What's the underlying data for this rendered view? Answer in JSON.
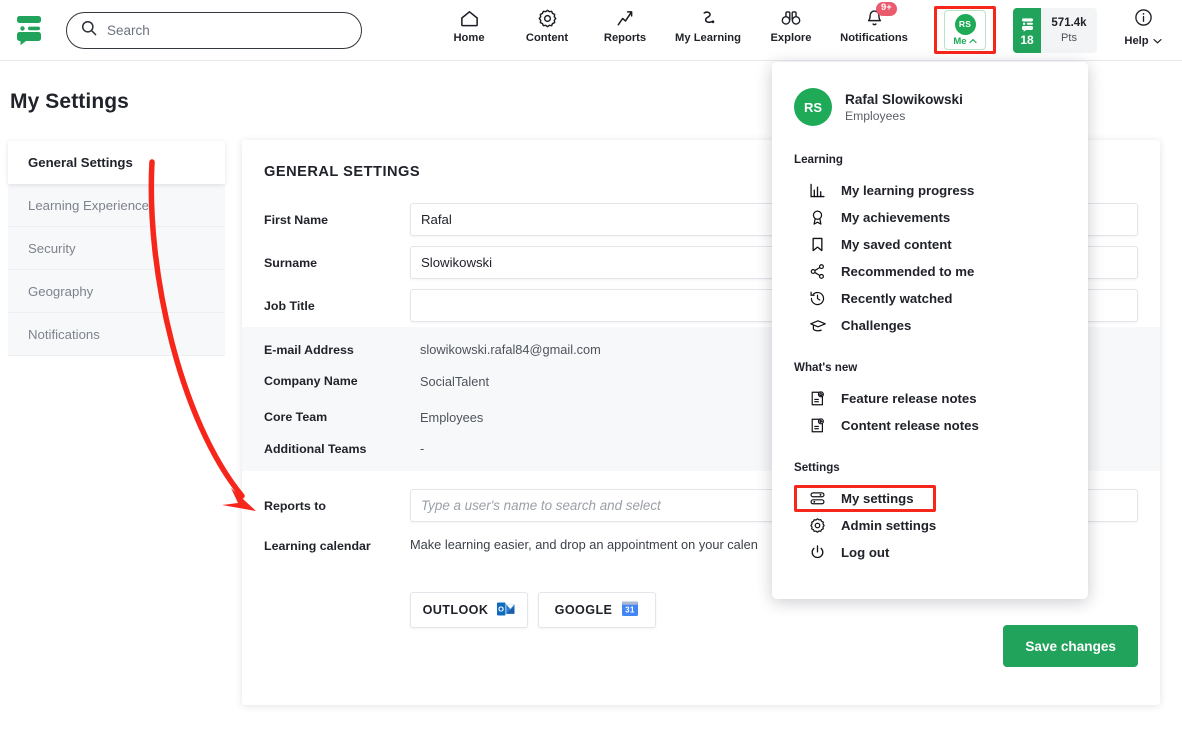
{
  "header": {
    "logo_icon": "socialtalent-logo-icon",
    "search": {
      "placeholder": "Search",
      "icon": "search-icon"
    },
    "nav": [
      {
        "label": "Home",
        "icon": "home-icon"
      },
      {
        "label": "Content",
        "icon": "gear-icon"
      },
      {
        "label": "Reports",
        "icon": "trend-arrow-icon"
      },
      {
        "label": "My Learning",
        "icon": "path-icon"
      },
      {
        "label": "Explore",
        "icon": "binoculars-icon"
      },
      {
        "label": "Notifications",
        "icon": "bell-icon",
        "badge": "9+"
      }
    ],
    "me": {
      "initials": "RS",
      "label": "Me",
      "chevron": "chevron-up-icon"
    },
    "points": {
      "level": "18",
      "value": "571.4k",
      "unit": "Pts"
    },
    "help": {
      "label": "Help",
      "icon": "info-circle-icon",
      "chevron": "chevron-down-icon"
    }
  },
  "page": {
    "title": "My Settings"
  },
  "sidebar": {
    "items": [
      {
        "label": "General Settings",
        "active": true
      },
      {
        "label": "Learning Experience",
        "active": false
      },
      {
        "label": "Security",
        "active": false
      },
      {
        "label": "Geography",
        "active": false
      },
      {
        "label": "Notifications",
        "active": false
      }
    ]
  },
  "main": {
    "card_title": "GENERAL SETTINGS",
    "fields": {
      "first_name": {
        "label": "First Name",
        "value": "Rafal"
      },
      "surname": {
        "label": "Surname",
        "value": "Slowikowski"
      },
      "job_title": {
        "label": "Job Title",
        "value": ""
      },
      "email": {
        "label": "E-mail Address",
        "value": "slowikowski.rafal84@gmail.com"
      },
      "company": {
        "label": "Company Name",
        "value": "SocialTalent"
      },
      "core_team": {
        "label": "Core Team",
        "value": "Employees"
      },
      "additional_teams": {
        "label": "Additional Teams",
        "value": "-"
      },
      "reports_to": {
        "label": "Reports to",
        "placeholder": "Type a user's name to search and select",
        "value": ""
      },
      "learning_calendar": {
        "label": "Learning calendar",
        "text": "Make learning easier, and drop an appointment on your calen",
        "outlook": "OUTLOOK",
        "google": "GOOGLE"
      }
    },
    "save_label": "Save changes"
  },
  "dropdown": {
    "user": {
      "initials": "RS",
      "name": "Rafal Slowikowski",
      "team": "Employees"
    },
    "sections": [
      {
        "title": "Learning",
        "items": [
          {
            "label": "My learning progress",
            "icon": "bar-chart-icon"
          },
          {
            "label": "My achievements",
            "icon": "award-ribbon-icon"
          },
          {
            "label": "My saved content",
            "icon": "bookmark-icon"
          },
          {
            "label": "Recommended to me",
            "icon": "share-nodes-icon"
          },
          {
            "label": "Recently watched",
            "icon": "clock-rewind-icon"
          },
          {
            "label": "Challenges",
            "icon": "graduation-cap-icon"
          }
        ]
      },
      {
        "title": "What's new",
        "items": [
          {
            "label": "Feature release notes",
            "icon": "document-star-icon"
          },
          {
            "label": "Content release notes",
            "icon": "document-play-icon"
          }
        ]
      },
      {
        "title": "Settings",
        "items": [
          {
            "label": "My settings",
            "icon": "sliders-icon",
            "highlighted": true
          },
          {
            "label": "Admin settings",
            "icon": "gear-icon"
          },
          {
            "label": "Log out",
            "icon": "power-icon"
          }
        ]
      }
    ]
  },
  "annotations": {
    "highlight_color": "#f6261b",
    "arrow_color": "#f6261b",
    "accent_green": "#22a35b",
    "badge_red": "#ea5c6d"
  }
}
